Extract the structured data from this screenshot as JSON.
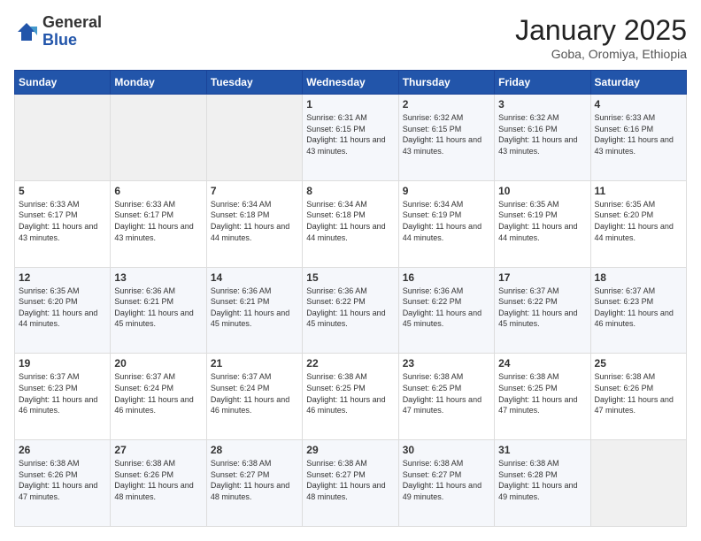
{
  "logo": {
    "general": "General",
    "blue": "Blue"
  },
  "header": {
    "month": "January 2025",
    "location": "Goba, Oromiya, Ethiopia"
  },
  "days_of_week": [
    "Sunday",
    "Monday",
    "Tuesday",
    "Wednesday",
    "Thursday",
    "Friday",
    "Saturday"
  ],
  "weeks": [
    [
      {
        "day": "",
        "sunrise": "",
        "sunset": "",
        "daylight": "",
        "empty": true
      },
      {
        "day": "",
        "sunrise": "",
        "sunset": "",
        "daylight": "",
        "empty": true
      },
      {
        "day": "",
        "sunrise": "",
        "sunset": "",
        "daylight": "",
        "empty": true
      },
      {
        "day": "1",
        "sunrise": "Sunrise: 6:31 AM",
        "sunset": "Sunset: 6:15 PM",
        "daylight": "Daylight: 11 hours and 43 minutes."
      },
      {
        "day": "2",
        "sunrise": "Sunrise: 6:32 AM",
        "sunset": "Sunset: 6:15 PM",
        "daylight": "Daylight: 11 hours and 43 minutes."
      },
      {
        "day": "3",
        "sunrise": "Sunrise: 6:32 AM",
        "sunset": "Sunset: 6:16 PM",
        "daylight": "Daylight: 11 hours and 43 minutes."
      },
      {
        "day": "4",
        "sunrise": "Sunrise: 6:33 AM",
        "sunset": "Sunset: 6:16 PM",
        "daylight": "Daylight: 11 hours and 43 minutes."
      }
    ],
    [
      {
        "day": "5",
        "sunrise": "Sunrise: 6:33 AM",
        "sunset": "Sunset: 6:17 PM",
        "daylight": "Daylight: 11 hours and 43 minutes."
      },
      {
        "day": "6",
        "sunrise": "Sunrise: 6:33 AM",
        "sunset": "Sunset: 6:17 PM",
        "daylight": "Daylight: 11 hours and 43 minutes."
      },
      {
        "day": "7",
        "sunrise": "Sunrise: 6:34 AM",
        "sunset": "Sunset: 6:18 PM",
        "daylight": "Daylight: 11 hours and 44 minutes."
      },
      {
        "day": "8",
        "sunrise": "Sunrise: 6:34 AM",
        "sunset": "Sunset: 6:18 PM",
        "daylight": "Daylight: 11 hours and 44 minutes."
      },
      {
        "day": "9",
        "sunrise": "Sunrise: 6:34 AM",
        "sunset": "Sunset: 6:19 PM",
        "daylight": "Daylight: 11 hours and 44 minutes."
      },
      {
        "day": "10",
        "sunrise": "Sunrise: 6:35 AM",
        "sunset": "Sunset: 6:19 PM",
        "daylight": "Daylight: 11 hours and 44 minutes."
      },
      {
        "day": "11",
        "sunrise": "Sunrise: 6:35 AM",
        "sunset": "Sunset: 6:20 PM",
        "daylight": "Daylight: 11 hours and 44 minutes."
      }
    ],
    [
      {
        "day": "12",
        "sunrise": "Sunrise: 6:35 AM",
        "sunset": "Sunset: 6:20 PM",
        "daylight": "Daylight: 11 hours and 44 minutes."
      },
      {
        "day": "13",
        "sunrise": "Sunrise: 6:36 AM",
        "sunset": "Sunset: 6:21 PM",
        "daylight": "Daylight: 11 hours and 45 minutes."
      },
      {
        "day": "14",
        "sunrise": "Sunrise: 6:36 AM",
        "sunset": "Sunset: 6:21 PM",
        "daylight": "Daylight: 11 hours and 45 minutes."
      },
      {
        "day": "15",
        "sunrise": "Sunrise: 6:36 AM",
        "sunset": "Sunset: 6:22 PM",
        "daylight": "Daylight: 11 hours and 45 minutes."
      },
      {
        "day": "16",
        "sunrise": "Sunrise: 6:36 AM",
        "sunset": "Sunset: 6:22 PM",
        "daylight": "Daylight: 11 hours and 45 minutes."
      },
      {
        "day": "17",
        "sunrise": "Sunrise: 6:37 AM",
        "sunset": "Sunset: 6:22 PM",
        "daylight": "Daylight: 11 hours and 45 minutes."
      },
      {
        "day": "18",
        "sunrise": "Sunrise: 6:37 AM",
        "sunset": "Sunset: 6:23 PM",
        "daylight": "Daylight: 11 hours and 46 minutes."
      }
    ],
    [
      {
        "day": "19",
        "sunrise": "Sunrise: 6:37 AM",
        "sunset": "Sunset: 6:23 PM",
        "daylight": "Daylight: 11 hours and 46 minutes."
      },
      {
        "day": "20",
        "sunrise": "Sunrise: 6:37 AM",
        "sunset": "Sunset: 6:24 PM",
        "daylight": "Daylight: 11 hours and 46 minutes."
      },
      {
        "day": "21",
        "sunrise": "Sunrise: 6:37 AM",
        "sunset": "Sunset: 6:24 PM",
        "daylight": "Daylight: 11 hours and 46 minutes."
      },
      {
        "day": "22",
        "sunrise": "Sunrise: 6:38 AM",
        "sunset": "Sunset: 6:25 PM",
        "daylight": "Daylight: 11 hours and 46 minutes."
      },
      {
        "day": "23",
        "sunrise": "Sunrise: 6:38 AM",
        "sunset": "Sunset: 6:25 PM",
        "daylight": "Daylight: 11 hours and 47 minutes."
      },
      {
        "day": "24",
        "sunrise": "Sunrise: 6:38 AM",
        "sunset": "Sunset: 6:25 PM",
        "daylight": "Daylight: 11 hours and 47 minutes."
      },
      {
        "day": "25",
        "sunrise": "Sunrise: 6:38 AM",
        "sunset": "Sunset: 6:26 PM",
        "daylight": "Daylight: 11 hours and 47 minutes."
      }
    ],
    [
      {
        "day": "26",
        "sunrise": "Sunrise: 6:38 AM",
        "sunset": "Sunset: 6:26 PM",
        "daylight": "Daylight: 11 hours and 47 minutes."
      },
      {
        "day": "27",
        "sunrise": "Sunrise: 6:38 AM",
        "sunset": "Sunset: 6:26 PM",
        "daylight": "Daylight: 11 hours and 48 minutes."
      },
      {
        "day": "28",
        "sunrise": "Sunrise: 6:38 AM",
        "sunset": "Sunset: 6:27 PM",
        "daylight": "Daylight: 11 hours and 48 minutes."
      },
      {
        "day": "29",
        "sunrise": "Sunrise: 6:38 AM",
        "sunset": "Sunset: 6:27 PM",
        "daylight": "Daylight: 11 hours and 48 minutes."
      },
      {
        "day": "30",
        "sunrise": "Sunrise: 6:38 AM",
        "sunset": "Sunset: 6:27 PM",
        "daylight": "Daylight: 11 hours and 49 minutes."
      },
      {
        "day": "31",
        "sunrise": "Sunrise: 6:38 AM",
        "sunset": "Sunset: 6:28 PM",
        "daylight": "Daylight: 11 hours and 49 minutes."
      },
      {
        "day": "",
        "sunrise": "",
        "sunset": "",
        "daylight": "",
        "empty": true
      }
    ]
  ]
}
